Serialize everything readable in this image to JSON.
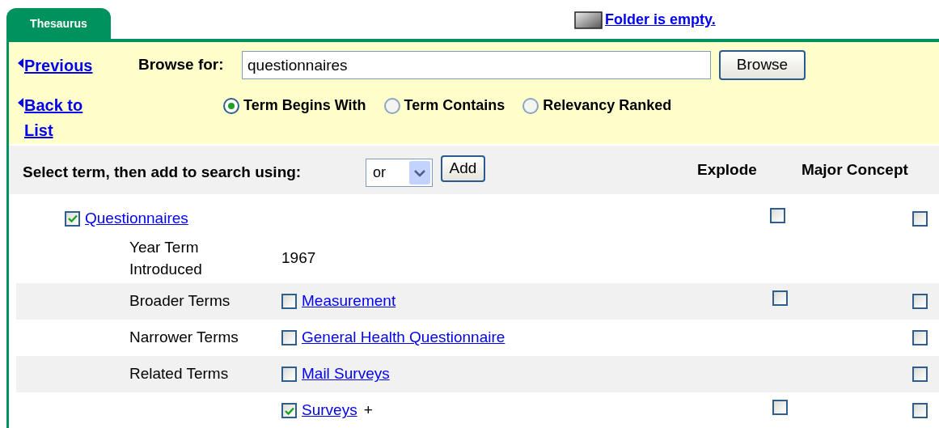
{
  "tab": {
    "label": "Thesaurus",
    "selected": true
  },
  "folder_link": "Folder is empty.",
  "nav": [
    {
      "kind": "previous",
      "label": "Previous"
    },
    {
      "kind": "back",
      "label": "Back to List"
    }
  ],
  "browse": {
    "label": "Browse for:",
    "value": "questionnaires",
    "button": "Browse"
  },
  "search_modes": [
    {
      "label": "Term Begins With",
      "selected": true
    },
    {
      "label": "Term Contains",
      "selected": false
    },
    {
      "label": "Relevancy Ranked",
      "selected": false
    }
  ],
  "add_bar": {
    "label": "Select term, then add to search using:",
    "operator": "or",
    "button": "Add"
  },
  "columns": [
    "Explode",
    "Major Concept"
  ],
  "term": {
    "label": "Questionnaires",
    "checked": true,
    "explode": false,
    "major": false
  },
  "year": {
    "label": "Year Term Introduced",
    "value": "1967"
  },
  "relations": [
    {
      "label": "Broader Terms",
      "term": "Measurement",
      "checked": false,
      "explode": false,
      "major": false
    },
    {
      "label": "Narrower Terms",
      "term": "General Health Questionnaire",
      "checked": false,
      "major": false
    },
    {
      "label": "Related Terms",
      "term": "Mail Surveys",
      "checked": false,
      "major": false
    },
    {
      "term": "Surveys",
      "more": "+",
      "checked": true,
      "explode": false,
      "major": false
    }
  ]
}
